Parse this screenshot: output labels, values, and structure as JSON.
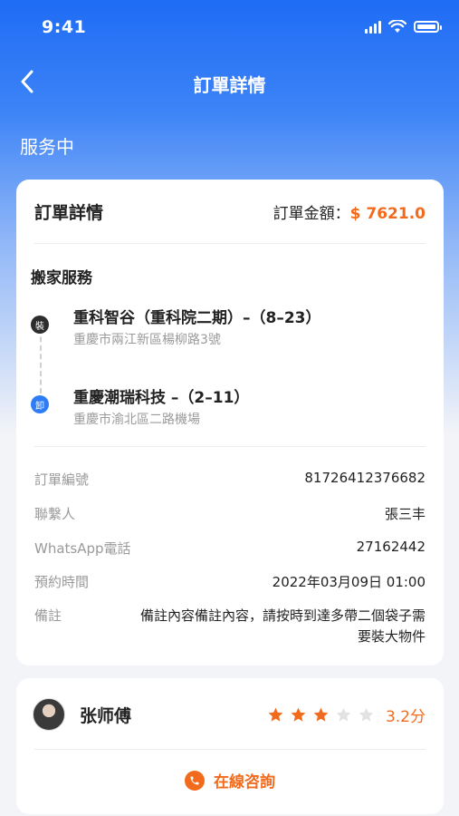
{
  "status_bar": {
    "time": "9:41"
  },
  "nav": {
    "title": "訂單詳情",
    "back_icon": "chevron-left-icon"
  },
  "status_label": "服务中",
  "order_card": {
    "title": "訂單詳情",
    "amount_label": "訂單金額：",
    "amount_value": "$ 7621.0",
    "service_title": "搬家服務",
    "pickup": {
      "badge": "裝",
      "name": "重科智谷（重科院二期）–（8–23）",
      "address": "重慶市兩江新區楊柳路3號"
    },
    "dropoff": {
      "badge": "卸",
      "name": "重慶潮瑞科技 –（2–11）",
      "address": "重慶市渝北區二路機場"
    },
    "info": {
      "order_no_label": "訂單編號",
      "order_no": "81726412376682",
      "contact_label": "聯繫人",
      "contact": "張三丰",
      "whatsapp_label": "WhatsApp電話",
      "whatsapp": "27162442",
      "time_label": "預約時間",
      "time": "2022年03月09日 01:00",
      "remark_label": "備註",
      "remark": "備註內容備註內容，請按時到達多帶二個袋子需要裝大物件"
    }
  },
  "master_card": {
    "name": "张师傅",
    "rating_value": 3.2,
    "rating_text": "3.2分",
    "stars_filled": 3,
    "stars_total": 5,
    "consult_label": "在線咨詢"
  },
  "colors": {
    "accent": "#f26b1d",
    "primary": "#1f6cf5",
    "star_empty": "#e2e2e2"
  }
}
